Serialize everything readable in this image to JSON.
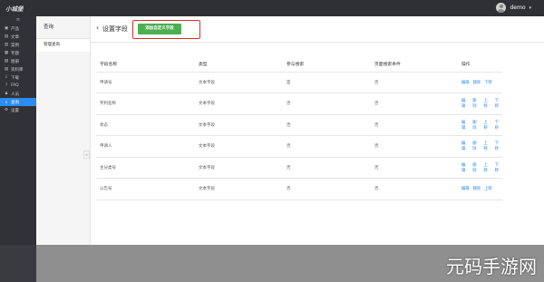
{
  "topbar": {
    "logo": "小城堡",
    "username": "demo",
    "caret": "▾"
  },
  "leftnav": {
    "toggle": "≡",
    "items": [
      {
        "icon": "▣",
        "label": "产品"
      },
      {
        "icon": "▤",
        "label": "文章"
      },
      {
        "icon": "▥",
        "label": "案例"
      },
      {
        "icon": "▦",
        "label": "专题"
      },
      {
        "icon": "▧",
        "label": "图册"
      },
      {
        "icon": "▨",
        "label": "资料库"
      },
      {
        "icon": "⇩",
        "label": "下载"
      },
      {
        "icon": "?",
        "label": "FAQ"
      },
      {
        "icon": "♟",
        "label": "人员"
      },
      {
        "icon": "⌕",
        "label": "查询"
      },
      {
        "icon": "⚙",
        "label": "设置"
      }
    ]
  },
  "subnav": {
    "title": "查询",
    "item": "管理查询",
    "collapse": "≡"
  },
  "page": {
    "back": "‹",
    "title": "设置字段",
    "add_button": "添加自定义字段"
  },
  "table": {
    "headers": [
      "字段名称",
      "类型",
      "参与搜索",
      "页面搜索条件",
      "操作"
    ],
    "rows": [
      {
        "name": "申请号",
        "type": "文本字段",
        "search": "是",
        "page": "否",
        "actions": [
          "编辑",
          "删除",
          "下移"
        ]
      },
      {
        "name": "专利名称",
        "type": "文本字段",
        "search": "否",
        "page": "否",
        "actions": [
          "编辑",
          "删除",
          "上移",
          "下移"
        ]
      },
      {
        "name": "状态",
        "type": "文本字段",
        "search": "否",
        "page": "否",
        "actions": [
          "编辑",
          "删除",
          "上移",
          "下移"
        ]
      },
      {
        "name": "申请人",
        "type": "文本字段",
        "search": "否",
        "page": "否",
        "actions": [
          "编辑",
          "删除",
          "上移",
          "下移"
        ]
      },
      {
        "name": "主分类号",
        "type": "文本字段",
        "search": "否",
        "page": "否",
        "actions": [
          "编辑",
          "删除",
          "上移",
          "下移"
        ]
      },
      {
        "name": "公告号",
        "type": "文本字段",
        "search": "否",
        "page": "否",
        "actions": [
          "编辑",
          "删除",
          "上移"
        ]
      }
    ]
  },
  "watermark": "元码手游网",
  "colors": {
    "active_nav": "#2d8cf0",
    "add_button": "#4caf50",
    "highlight_box": "#d9302c",
    "link": "#2d8cf0"
  }
}
